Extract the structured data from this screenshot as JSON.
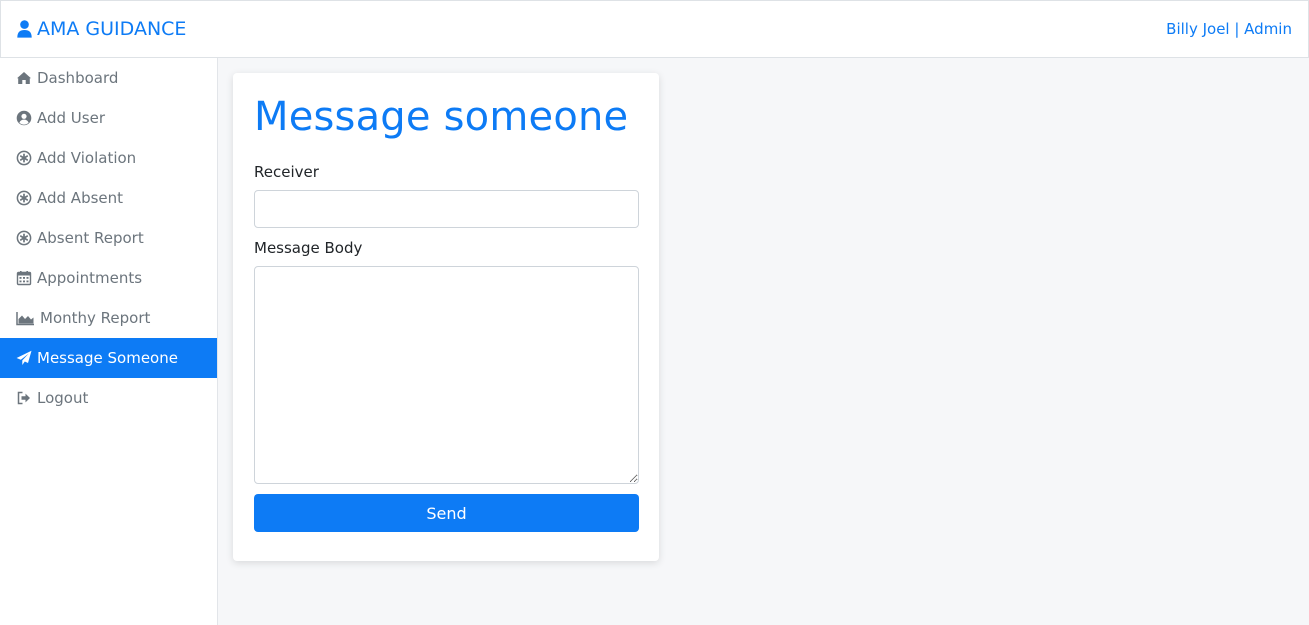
{
  "header": {
    "brand_label": "AMA GUIDANCE",
    "brand_icon": "user-icon",
    "user_label": "Billy Joel | Admin"
  },
  "sidebar": {
    "items": [
      {
        "label": "Dashboard",
        "icon": "home-icon",
        "active": false
      },
      {
        "label": "Add User",
        "icon": "user-circle-icon",
        "active": false
      },
      {
        "label": "Add Violation",
        "icon": "asterisk-circle-icon",
        "active": false
      },
      {
        "label": "Add Absent",
        "icon": "asterisk-circle-icon",
        "active": false
      },
      {
        "label": "Absent Report",
        "icon": "asterisk-circle-icon",
        "active": false
      },
      {
        "label": "Appointments",
        "icon": "calendar-icon",
        "active": false
      },
      {
        "label": "Monthy Report",
        "icon": "area-chart-icon",
        "active": false
      },
      {
        "label": "Message Someone",
        "icon": "paper-plane-icon",
        "active": true
      },
      {
        "label": "Logout",
        "icon": "sign-out-icon",
        "active": false
      }
    ]
  },
  "form": {
    "title": "Message someone",
    "receiver_label": "Receiver",
    "receiver_value": "",
    "body_label": "Message Body",
    "body_value": "",
    "send_label": "Send"
  },
  "colors": {
    "accent": "#0d7bf5",
    "sidebar_text": "#6c757d",
    "background": "#f6f7f9"
  }
}
